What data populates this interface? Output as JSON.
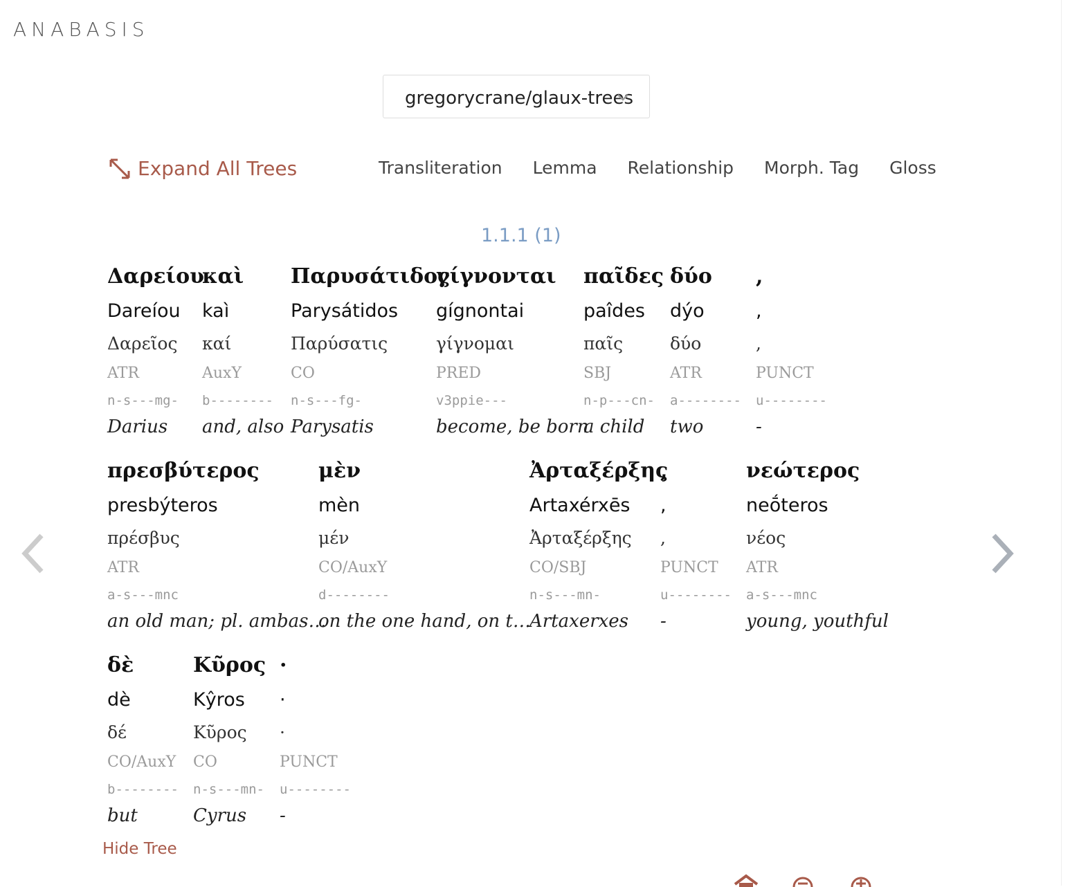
{
  "app": {
    "title": "ANABASIS"
  },
  "repo": {
    "selected": "gregorycrane/glaux-trees"
  },
  "toolbar": {
    "expand_all": "Expand All Trees",
    "toggles": [
      "Transliteration",
      "Lemma",
      "Relationship",
      "Morph. Tag",
      "Gloss"
    ]
  },
  "sentence": {
    "ref": "1.1.1 (1)"
  },
  "rows": [
    [
      {
        "greek": "Δαρείου",
        "translit": "Dareíou",
        "lemma": "Δαρεῖος",
        "rel": "ATR",
        "morph": "n-s---mg-",
        "gloss": "Darius"
      },
      {
        "greek": "καὶ",
        "translit": "kaì",
        "lemma": "καί",
        "rel": "AuxY",
        "morph": "b--------",
        "gloss": "and, also"
      },
      {
        "greek": "Παρυσάτιδος",
        "translit": "Parysátidos",
        "lemma": "Παρύσατις",
        "rel": "CO",
        "morph": "n-s---fg-",
        "gloss": "Parysatis"
      },
      {
        "greek": "γίγνονται",
        "translit": "gígnontai",
        "lemma": "γίγνομαι",
        "rel": "PRED",
        "morph": "v3ppie---",
        "gloss": "become, be born"
      },
      {
        "greek": "παῖδες",
        "translit": "paîdes",
        "lemma": "παῖς",
        "rel": "SBJ",
        "morph": "n-p---cn-",
        "gloss": "a child"
      },
      {
        "greek": "δύο",
        "translit": "dýo",
        "lemma": "δύο",
        "rel": "ATR",
        "morph": "a--------",
        "gloss": "two"
      },
      {
        "greek": ",",
        "translit": ",",
        "lemma": ",",
        "rel": "PUNCT",
        "morph": "u--------",
        "gloss": "-"
      }
    ],
    [
      {
        "greek": "πρεσβύτερος",
        "translit": "presbýteros",
        "lemma": "πρέσβυς",
        "rel": "ATR",
        "morph": "a-s---mnc",
        "gloss": "an old man; pl. ambas…"
      },
      {
        "greek": "μὲν",
        "translit": "mèn",
        "lemma": "μέν",
        "rel": "CO/AuxY",
        "morph": "d--------",
        "gloss": "on the one hand, on t…"
      },
      {
        "greek": "Ἀρταξέρξης",
        "translit": "Artaxérxēs",
        "lemma": "Ἀρταξέρξης",
        "rel": "CO/SBJ",
        "morph": "n-s---mn-",
        "gloss": "Artaxerxes"
      },
      {
        "greek": ",",
        "translit": ",",
        "lemma": ",",
        "rel": "PUNCT",
        "morph": "u--------",
        "gloss": "-"
      },
      {
        "greek": "νεώτερος",
        "translit": "neṓteros",
        "lemma": "νέος",
        "rel": "ATR",
        "morph": "a-s---mnc",
        "gloss": "young, youthful"
      }
    ],
    [
      {
        "greek": "δὲ",
        "translit": "dè",
        "lemma": "δέ",
        "rel": "CO/AuxY",
        "morph": "b--------",
        "gloss": "but"
      },
      {
        "greek": "Κῦρος",
        "translit": "Kŷros",
        "lemma": "Κῦρος",
        "rel": "CO",
        "morph": "n-s---mn-",
        "gloss": "Cyrus"
      },
      {
        "greek": "·",
        "translit": "·",
        "lemma": "·",
        "rel": "PUNCT",
        "morph": "u--------",
        "gloss": "-"
      }
    ]
  ],
  "hide_tree": "Hide Tree",
  "colors": {
    "accent": "#a85a4a",
    "ref": "#7a9cc4",
    "muted": "#9a9a9a"
  },
  "icons": [
    "expand-arrows-icon",
    "chevron-down-icon",
    "prev-arrow-icon",
    "next-arrow-icon",
    "home-icon",
    "zoom-out-icon",
    "zoom-in-icon"
  ]
}
